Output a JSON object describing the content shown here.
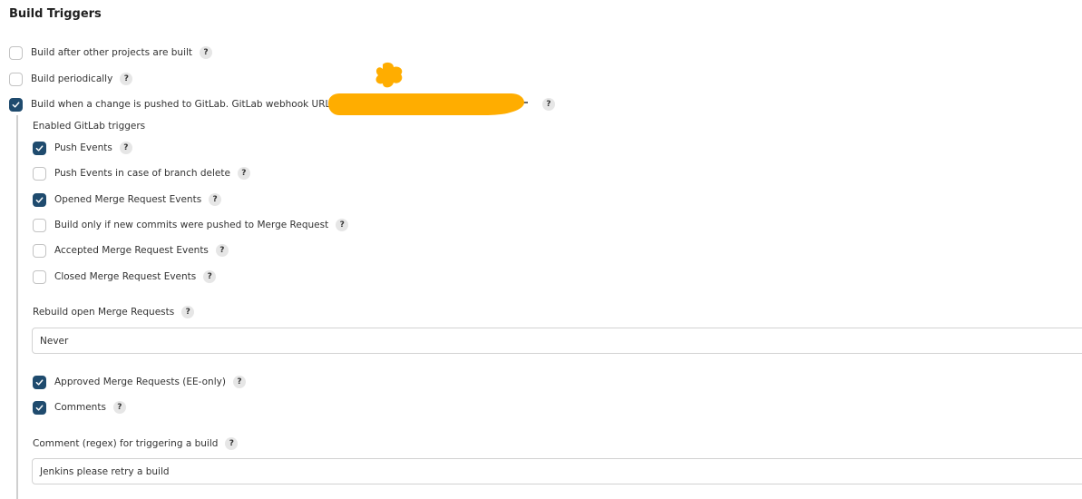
{
  "section": {
    "title": "Build Triggers"
  },
  "triggers": [
    {
      "label": "Build after other projects are built",
      "checked": false
    },
    {
      "label": "Build periodically",
      "checked": false
    },
    {
      "label": "Build when a change is pushed to GitLab. GitLab webhook URL:",
      "checked": true
    }
  ],
  "gitlab": {
    "enabled_label": "Enabled GitLab triggers",
    "events": [
      {
        "label": "Push Events",
        "checked": true
      },
      {
        "label": "Push Events in case of branch delete",
        "checked": false
      },
      {
        "label": "Opened Merge Request Events",
        "checked": true
      },
      {
        "label": "Build only if new commits were pushed to Merge Request",
        "checked": false
      },
      {
        "label": "Accepted Merge Request Events",
        "checked": false
      },
      {
        "label": "Closed Merge Request Events",
        "checked": false
      }
    ],
    "rebuild": {
      "label": "Rebuild open Merge Requests",
      "value": "Never"
    },
    "extra_events": [
      {
        "label": "Approved Merge Requests (EE-only)",
        "checked": true
      },
      {
        "label": "Comments",
        "checked": true
      }
    ],
    "comment_regex": {
      "label": "Comment (regex) for triggering a build",
      "value": "Jenkins please retry a build"
    }
  },
  "help_glyph": "?",
  "colors": {
    "checkbox_checked": "#1f4b6e",
    "redaction": "#ffad00"
  }
}
